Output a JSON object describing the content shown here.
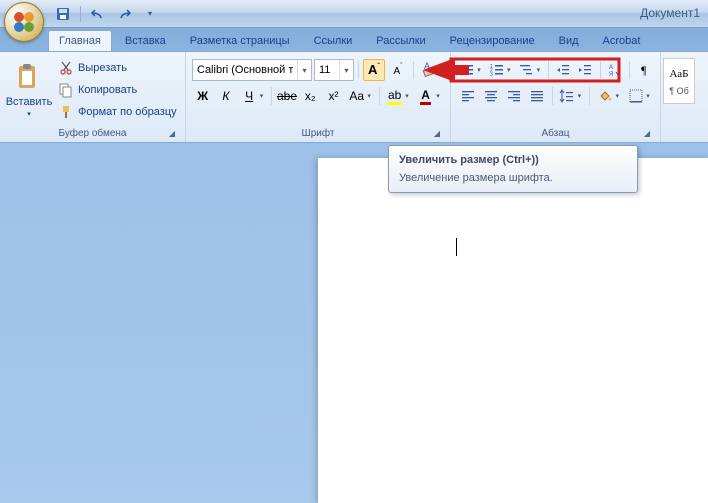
{
  "window": {
    "title": "Документ1"
  },
  "tabs": {
    "home": "Главная",
    "insert": "Вставка",
    "layout": "Разметка страницы",
    "references": "Ссылки",
    "mailings": "Рассылки",
    "review": "Рецензирование",
    "view": "Вид",
    "acrobat": "Acrobat"
  },
  "clipboard": {
    "paste": "Вставить",
    "cut": "Вырезать",
    "copy": "Копировать",
    "format_painter": "Формат по образцу",
    "group_title": "Буфер обмена"
  },
  "font": {
    "name_value": "Calibri (Основной те",
    "size_value": "11",
    "group_title": "Шрифт",
    "buttons": {
      "bold": "Ж",
      "italic": "К",
      "underline": "Ч",
      "strike": "abe",
      "sub": "x₂",
      "sup": "x²",
      "case": "Aa",
      "highlight": "ab",
      "color": "A"
    }
  },
  "paragraph": {
    "group_title": "Абзац"
  },
  "styles": {
    "preview_text": "АаБ",
    "preview_label": "¶ Об"
  },
  "tooltip": {
    "title": "Увеличить размер (Ctrl+))",
    "body": "Увеличение размера шрифта."
  },
  "colors": {
    "highlight": "#ffff00",
    "font_color_underline": "#c00000"
  }
}
